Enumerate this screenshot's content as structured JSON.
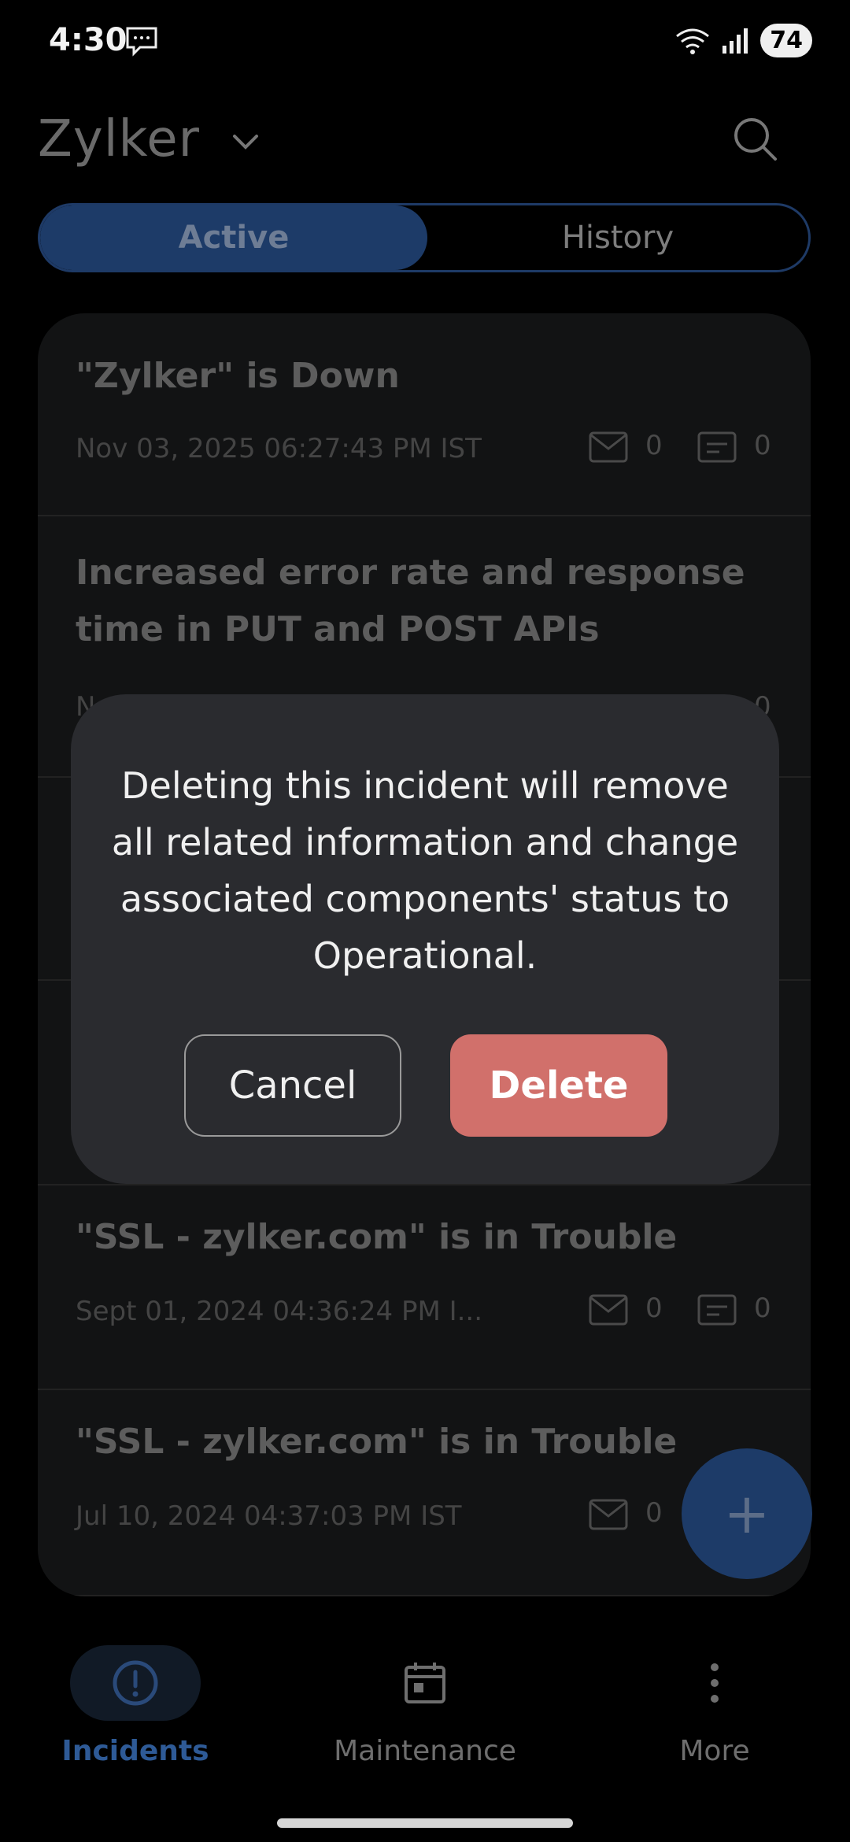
{
  "status_bar": {
    "time": "4:30",
    "battery": "74"
  },
  "header": {
    "org_name": "Zylker"
  },
  "tabs": {
    "active": "Active",
    "history": "History"
  },
  "incidents": [
    {
      "title": "\"Zylker\" is Down",
      "date": "Nov 03, 2025 06:27:43 PM IST",
      "mail_count": "0",
      "note_count": "0"
    },
    {
      "title": "Increased error rate and response time in PUT and POST APIs",
      "date": "N",
      "mail_count": "",
      "note_count": "0"
    },
    {
      "title": "\"SSL - zylker.com\" is in Trouble",
      "date": "Sept 01, 2024 04:36:24 PM I...",
      "mail_count": "0",
      "note_count": "0"
    },
    {
      "title": "\"SSL - zylker.com\" is in Trouble",
      "date": "Jul 10, 2024 04:37:03 PM IST",
      "mail_count": "0",
      "note_count": ""
    }
  ],
  "fab": {
    "label": "+"
  },
  "bottom_nav": [
    {
      "label": "Incidents",
      "icon": "alert-circle-icon",
      "active": true
    },
    {
      "label": "Maintenance",
      "icon": "calendar-icon",
      "active": false
    },
    {
      "label": "More",
      "icon": "more-vertical-icon",
      "active": false
    }
  ],
  "dialog": {
    "message": "Deleting this incident will remove all related information and change associated components' status to Operational.",
    "cancel_label": "Cancel",
    "delete_label": "Delete"
  },
  "colors": {
    "accent": "#1d3b68",
    "accent_text": "#3a66a8",
    "danger": "#d1706b",
    "dialog_bg": "#2a2b2f"
  }
}
